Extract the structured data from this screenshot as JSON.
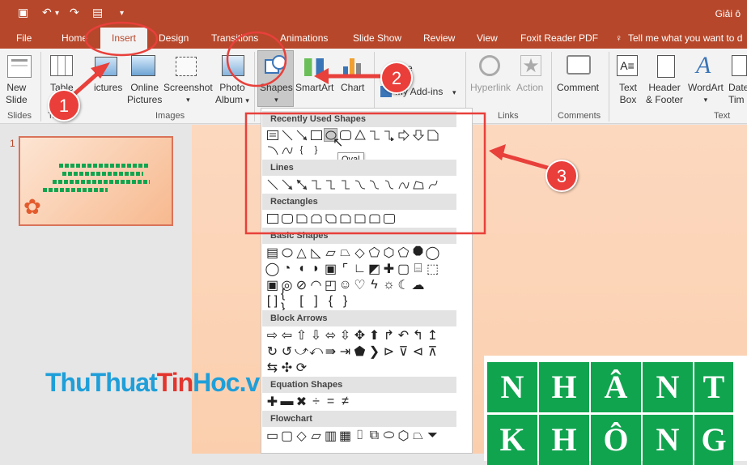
{
  "titlebar": {
    "title": "Giải ô"
  },
  "tabs": [
    "File",
    "Home",
    "Insert",
    "Design",
    "Transitions",
    "Animations",
    "Slide Show",
    "Review",
    "View",
    "Foxit Reader PDF"
  ],
  "tell_me": "Tell me what you want to d",
  "ribbon": {
    "new_slide": "New",
    "new_slide2": "Slide",
    "table": "Table",
    "pictures": "ictures",
    "online_pictures": "Online",
    "online_pictures2": "Pictures",
    "screenshot": "Screenshot",
    "photo_album": "Photo",
    "photo_album2": "Album",
    "shapes": "Shapes",
    "smartart": "SmartArt",
    "chart": "Chart",
    "store": "re",
    "my_addins": "My Add-ins",
    "hyperlink": "Hyperlink",
    "action": "Action",
    "comment": "Comment",
    "textbox": "Text",
    "textbox2": "Box",
    "headerfooter": "Header",
    "headerfooter2": "& Footer",
    "wordart": "WordArt",
    "datetime": "Date",
    "datetime2": "Tim"
  },
  "groups": {
    "slides": "Slides",
    "ta": "Ta",
    "images": "Images",
    "links": "Links",
    "comments": "Comments",
    "text": "Text"
  },
  "slide_number": "1",
  "gallery": {
    "sections": [
      "Recently Used Shapes",
      "Lines",
      "Rectangles",
      "Basic Shapes",
      "Block Arrows",
      "Equation Shapes",
      "Flowchart"
    ],
    "tooltip": "Oval"
  },
  "callouts": [
    "1",
    "2",
    "3"
  ],
  "slide_tiles": {
    "row1": [
      "N",
      "H",
      "Â",
      "N",
      "T"
    ],
    "row2": [
      "K",
      "H",
      "Ô",
      "N",
      "G"
    ]
  },
  "watermark": {
    "a": "Thu",
    "b": "Thuat",
    "c": "Tin",
    "d": "Hoc",
    "e": ".vn"
  },
  "colors": {
    "accent": "#b7472a",
    "callout": "#ea3e3b",
    "tile": "#11a44f"
  }
}
